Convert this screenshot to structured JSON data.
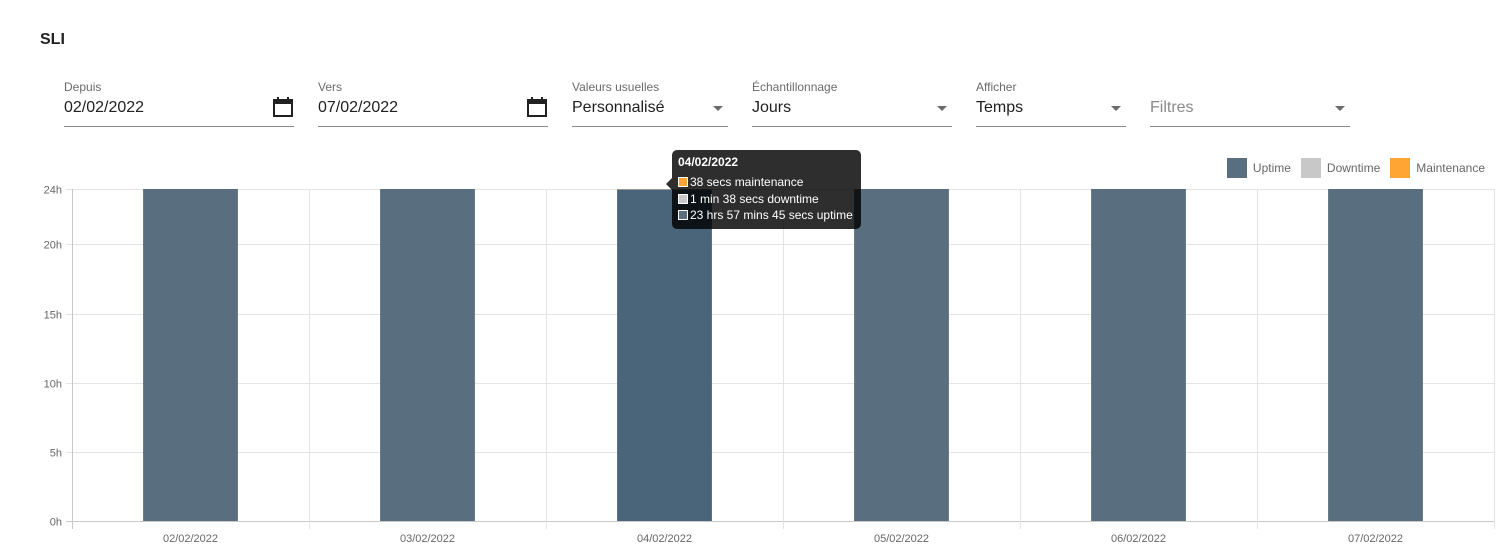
{
  "page": {
    "title": "SLI"
  },
  "filters": {
    "from": {
      "label": "Depuis",
      "value": "02/02/2022",
      "icon": "calendar-icon"
    },
    "to": {
      "label": "Vers",
      "value": "07/02/2022",
      "icon": "calendar-icon"
    },
    "presets": {
      "label": "Valeurs usuelles",
      "value": "Personnalisé"
    },
    "sampling": {
      "label": "Échantillonnage",
      "value": "Jours"
    },
    "display": {
      "label": "Afficher",
      "value": "Temps"
    },
    "filters": {
      "placeholder": "Filtres"
    }
  },
  "colors": {
    "uptime": "#596e7e",
    "uptime_hover": "#4a6479",
    "downtime": "#c8c8c8",
    "maintenance": "#ffa534"
  },
  "tooltip": {
    "title": "04/02/2022",
    "rows": [
      {
        "text": "38 secs maintenance",
        "series": "maintenance"
      },
      {
        "text": "1 min 38 secs downtime",
        "series": "downtime"
      },
      {
        "text": "23 hrs 57 mins 45 secs uptime",
        "series": "uptime"
      }
    ]
  },
  "chart_data": {
    "type": "bar",
    "stacked": true,
    "title": "",
    "xlabel": "",
    "ylabel": "",
    "categories": [
      "02/02/2022",
      "03/02/2022",
      "04/02/2022",
      "05/02/2022",
      "06/02/2022",
      "07/02/2022"
    ],
    "series": [
      {
        "name": "Uptime",
        "key": "uptime",
        "values_hours": [
          24,
          24,
          23.9625,
          24,
          24,
          24
        ]
      },
      {
        "name": "Downtime",
        "key": "downtime",
        "values_hours": [
          0,
          0,
          0.0272,
          0,
          0,
          0
        ]
      },
      {
        "name": "Maintenance",
        "key": "maintenance",
        "values_hours": [
          0,
          0,
          0.0106,
          0,
          0,
          0
        ]
      }
    ],
    "ylim": [
      0,
      24
    ],
    "yticks": [
      0,
      5,
      10,
      15,
      20,
      24
    ],
    "ytick_labels": [
      "0h",
      "5h",
      "10h",
      "15h",
      "20h",
      "24h"
    ],
    "highlighted_category": "04/02/2022",
    "grid": true,
    "legend": {
      "position": "top-right",
      "entries": [
        "Uptime",
        "Downtime",
        "Maintenance"
      ]
    }
  }
}
